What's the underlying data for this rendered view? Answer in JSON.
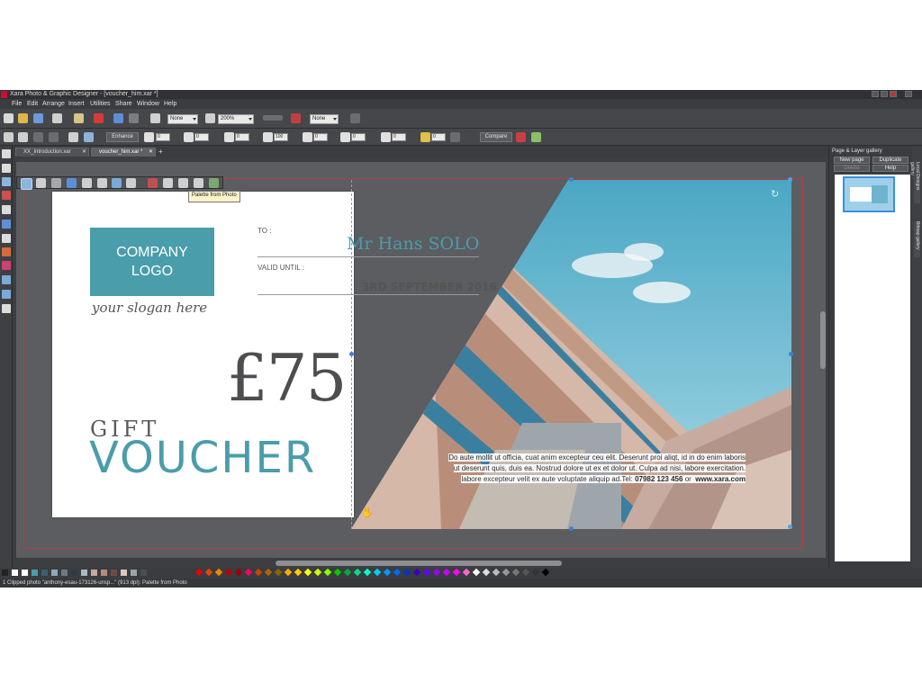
{
  "window": {
    "title": "Xara Photo & Graphic Designer - [voucher_him.xar *]"
  },
  "menu": [
    "File",
    "Edit",
    "Arrange",
    "Insert",
    "Utilities",
    "Share",
    "Window",
    "Help"
  ],
  "toolbar": {
    "quality_value": "None",
    "zoom_value": "200%",
    "feather_value": "None",
    "enhance_label": "Enhance",
    "compare_label": "Compare",
    "field_values": [
      "0",
      "0",
      "0",
      "100",
      "0",
      "0",
      "0",
      "0",
      "0"
    ]
  },
  "tabs": [
    {
      "label": "XX_Introduction.xar"
    },
    {
      "label": "voucher_him.xar *"
    }
  ],
  "tooltip": "Palette from Photo",
  "voucher": {
    "logo_line1": "COMPANY",
    "logo_line2": "LOGO",
    "slogan": "your slogan here",
    "to_label": "TO :",
    "recipient": "Mr Hans SOLO",
    "valid_label": "VALID UNTIL :",
    "valid_date": "3RD SEPTEMBER 2016",
    "amount": "£75",
    "gift": "GIFT",
    "voucher": "VOUCHER",
    "body_lines": [
      "Do aute mollit ut officia, cuat anim excepteur ceu elit. Deserunt proi aliqt, id in do enim laboris",
      "ut deserunt quis, duis ea. Nostrud dolore ut ex et dolor ut. Culpa ad nisi, labore exercitation.",
      "labore excepteur velit ex aute voluptate aliquip ad.Tel:"
    ],
    "phone": "07982 123 456",
    "or_text": "or",
    "website": "www.xara.com"
  },
  "gallery": {
    "title": "Page & Layer gallery",
    "new_page": "New page",
    "duplicate": "Duplicate",
    "delete": "Delete",
    "help": "Help"
  },
  "side_tabs": [
    "Local Designs gallery",
    "Bitmap gallery"
  ],
  "status": "1 Clipped photo \"anthony-esau-173126-unsp...\" (913 dpi): Palette from Photo",
  "colors": {
    "accent": "#4a9daa",
    "dark_text": "#4d4e50",
    "app_bg": "#3c3e42"
  }
}
